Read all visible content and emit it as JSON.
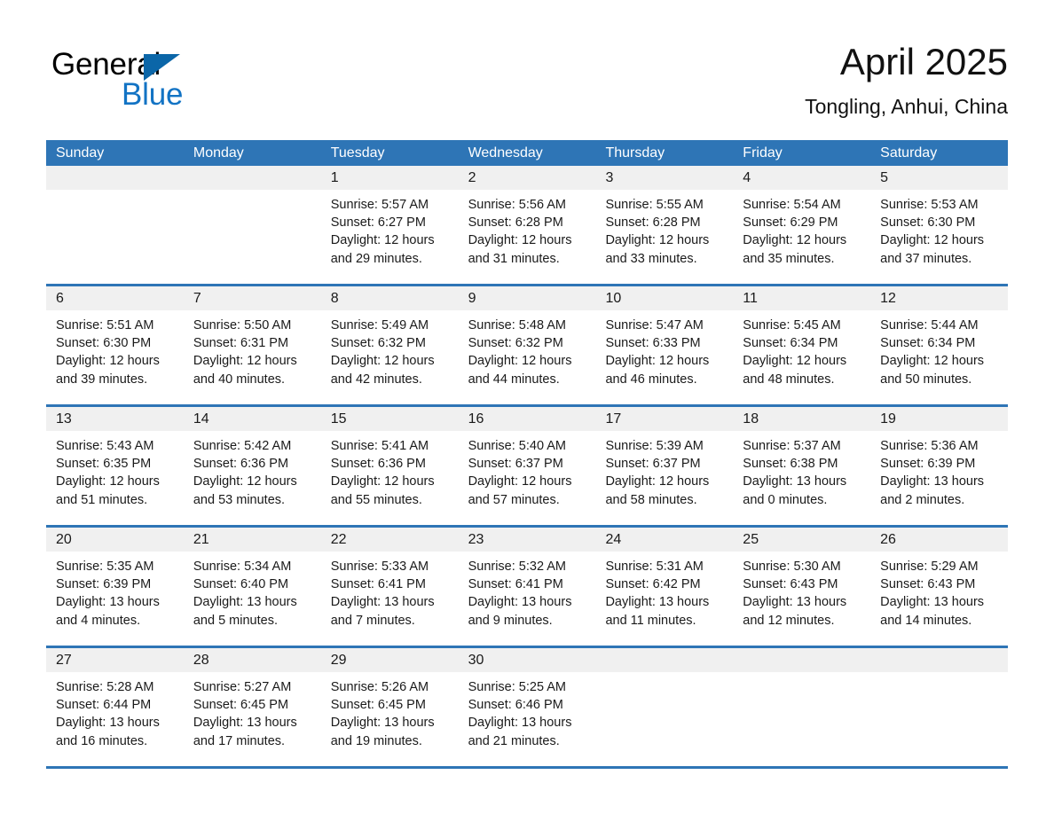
{
  "brand": {
    "name_part1": "General",
    "name_part2": "Blue",
    "triangle_color": "#0b66a8",
    "blue_color": "#1273c4"
  },
  "header": {
    "title": "April 2025",
    "subtitle": "Tongling, Anhui, China"
  },
  "theme": {
    "header_blue": "#2e75b6",
    "daynum_gray": "#f0f0f0",
    "body_white": "#ffffff"
  },
  "weekdays": [
    "Sunday",
    "Monday",
    "Tuesday",
    "Wednesday",
    "Thursday",
    "Friday",
    "Saturday"
  ],
  "weeks": [
    {
      "days": [
        {
          "num": "",
          "lines": [
            "",
            "",
            "",
            ""
          ],
          "empty": true
        },
        {
          "num": "",
          "lines": [
            "",
            "",
            "",
            ""
          ],
          "empty": true
        },
        {
          "num": "1",
          "lines": [
            "Sunrise: 5:57 AM",
            "Sunset: 6:27 PM",
            "Daylight: 12 hours",
            "and 29 minutes."
          ],
          "empty": false
        },
        {
          "num": "2",
          "lines": [
            "Sunrise: 5:56 AM",
            "Sunset: 6:28 PM",
            "Daylight: 12 hours",
            "and 31 minutes."
          ],
          "empty": false
        },
        {
          "num": "3",
          "lines": [
            "Sunrise: 5:55 AM",
            "Sunset: 6:28 PM",
            "Daylight: 12 hours",
            "and 33 minutes."
          ],
          "empty": false
        },
        {
          "num": "4",
          "lines": [
            "Sunrise: 5:54 AM",
            "Sunset: 6:29 PM",
            "Daylight: 12 hours",
            "and 35 minutes."
          ],
          "empty": false
        },
        {
          "num": "5",
          "lines": [
            "Sunrise: 5:53 AM",
            "Sunset: 6:30 PM",
            "Daylight: 12 hours",
            "and 37 minutes."
          ],
          "empty": false
        }
      ]
    },
    {
      "days": [
        {
          "num": "6",
          "lines": [
            "Sunrise: 5:51 AM",
            "Sunset: 6:30 PM",
            "Daylight: 12 hours",
            "and 39 minutes."
          ],
          "empty": false
        },
        {
          "num": "7",
          "lines": [
            "Sunrise: 5:50 AM",
            "Sunset: 6:31 PM",
            "Daylight: 12 hours",
            "and 40 minutes."
          ],
          "empty": false
        },
        {
          "num": "8",
          "lines": [
            "Sunrise: 5:49 AM",
            "Sunset: 6:32 PM",
            "Daylight: 12 hours",
            "and 42 minutes."
          ],
          "empty": false
        },
        {
          "num": "9",
          "lines": [
            "Sunrise: 5:48 AM",
            "Sunset: 6:32 PM",
            "Daylight: 12 hours",
            "and 44 minutes."
          ],
          "empty": false
        },
        {
          "num": "10",
          "lines": [
            "Sunrise: 5:47 AM",
            "Sunset: 6:33 PM",
            "Daylight: 12 hours",
            "and 46 minutes."
          ],
          "empty": false
        },
        {
          "num": "11",
          "lines": [
            "Sunrise: 5:45 AM",
            "Sunset: 6:34 PM",
            "Daylight: 12 hours",
            "and 48 minutes."
          ],
          "empty": false
        },
        {
          "num": "12",
          "lines": [
            "Sunrise: 5:44 AM",
            "Sunset: 6:34 PM",
            "Daylight: 12 hours",
            "and 50 minutes."
          ],
          "empty": false
        }
      ]
    },
    {
      "days": [
        {
          "num": "13",
          "lines": [
            "Sunrise: 5:43 AM",
            "Sunset: 6:35 PM",
            "Daylight: 12 hours",
            "and 51 minutes."
          ],
          "empty": false
        },
        {
          "num": "14",
          "lines": [
            "Sunrise: 5:42 AM",
            "Sunset: 6:36 PM",
            "Daylight: 12 hours",
            "and 53 minutes."
          ],
          "empty": false
        },
        {
          "num": "15",
          "lines": [
            "Sunrise: 5:41 AM",
            "Sunset: 6:36 PM",
            "Daylight: 12 hours",
            "and 55 minutes."
          ],
          "empty": false
        },
        {
          "num": "16",
          "lines": [
            "Sunrise: 5:40 AM",
            "Sunset: 6:37 PM",
            "Daylight: 12 hours",
            "and 57 minutes."
          ],
          "empty": false
        },
        {
          "num": "17",
          "lines": [
            "Sunrise: 5:39 AM",
            "Sunset: 6:37 PM",
            "Daylight: 12 hours",
            "and 58 minutes."
          ],
          "empty": false
        },
        {
          "num": "18",
          "lines": [
            "Sunrise: 5:37 AM",
            "Sunset: 6:38 PM",
            "Daylight: 13 hours",
            "and 0 minutes."
          ],
          "empty": false
        },
        {
          "num": "19",
          "lines": [
            "Sunrise: 5:36 AM",
            "Sunset: 6:39 PM",
            "Daylight: 13 hours",
            "and 2 minutes."
          ],
          "empty": false
        }
      ]
    },
    {
      "days": [
        {
          "num": "20",
          "lines": [
            "Sunrise: 5:35 AM",
            "Sunset: 6:39 PM",
            "Daylight: 13 hours",
            "and 4 minutes."
          ],
          "empty": false
        },
        {
          "num": "21",
          "lines": [
            "Sunrise: 5:34 AM",
            "Sunset: 6:40 PM",
            "Daylight: 13 hours",
            "and 5 minutes."
          ],
          "empty": false
        },
        {
          "num": "22",
          "lines": [
            "Sunrise: 5:33 AM",
            "Sunset: 6:41 PM",
            "Daylight: 13 hours",
            "and 7 minutes."
          ],
          "empty": false
        },
        {
          "num": "23",
          "lines": [
            "Sunrise: 5:32 AM",
            "Sunset: 6:41 PM",
            "Daylight: 13 hours",
            "and 9 minutes."
          ],
          "empty": false
        },
        {
          "num": "24",
          "lines": [
            "Sunrise: 5:31 AM",
            "Sunset: 6:42 PM",
            "Daylight: 13 hours",
            "and 11 minutes."
          ],
          "empty": false
        },
        {
          "num": "25",
          "lines": [
            "Sunrise: 5:30 AM",
            "Sunset: 6:43 PM",
            "Daylight: 13 hours",
            "and 12 minutes."
          ],
          "empty": false
        },
        {
          "num": "26",
          "lines": [
            "Sunrise: 5:29 AM",
            "Sunset: 6:43 PM",
            "Daylight: 13 hours",
            "and 14 minutes."
          ],
          "empty": false
        }
      ]
    },
    {
      "days": [
        {
          "num": "27",
          "lines": [
            "Sunrise: 5:28 AM",
            "Sunset: 6:44 PM",
            "Daylight: 13 hours",
            "and 16 minutes."
          ],
          "empty": false
        },
        {
          "num": "28",
          "lines": [
            "Sunrise: 5:27 AM",
            "Sunset: 6:45 PM",
            "Daylight: 13 hours",
            "and 17 minutes."
          ],
          "empty": false
        },
        {
          "num": "29",
          "lines": [
            "Sunrise: 5:26 AM",
            "Sunset: 6:45 PM",
            "Daylight: 13 hours",
            "and 19 minutes."
          ],
          "empty": false
        },
        {
          "num": "30",
          "lines": [
            "Sunrise: 5:25 AM",
            "Sunset: 6:46 PM",
            "Daylight: 13 hours",
            "and 21 minutes."
          ],
          "empty": false
        },
        {
          "num": "",
          "lines": [
            "",
            "",
            "",
            ""
          ],
          "empty": true
        },
        {
          "num": "",
          "lines": [
            "",
            "",
            "",
            ""
          ],
          "empty": true
        },
        {
          "num": "",
          "lines": [
            "",
            "",
            "",
            ""
          ],
          "empty": true
        }
      ]
    }
  ]
}
